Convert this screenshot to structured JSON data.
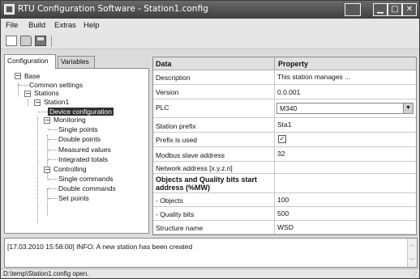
{
  "window": {
    "title": "RTU Configuration Software - Station1.config"
  },
  "menu": {
    "file": "File",
    "build": "Build",
    "extras": "Extras",
    "help": "Help"
  },
  "tabs": {
    "configuration": "Configuration",
    "variables": "Variables"
  },
  "tree": {
    "base": "Base",
    "common_settings": "Common settings",
    "stations": "Stations",
    "station1": "Station1",
    "device_configuration": "Device configuration",
    "monitoring": "Monitoring",
    "single_points": "Single points",
    "double_points": "Double points",
    "measured_values": "Measured values",
    "integrated_totals": "Integrated totals",
    "controlling": "Controlling",
    "single_commands": "Single commands",
    "double_commands": "Double commands",
    "set_points": "Set points"
  },
  "grid": {
    "header_data": "Data",
    "header_property": "Property",
    "rows": [
      {
        "key": "Description",
        "value": "This station manages ..."
      },
      {
        "key": "Version",
        "value": "0.0.001"
      },
      {
        "key": "PLC",
        "value": "M340"
      },
      {
        "key": "Station prefix",
        "value": "Sta1"
      },
      {
        "key": "Prefix is used",
        "value": "checked"
      },
      {
        "key": "Modbus slave address",
        "value": "32"
      },
      {
        "key": "Network address [x.y.z.n]",
        "value": ""
      },
      {
        "key": "Objects and Quality bits start address (%MW)",
        "value": ""
      },
      {
        "key": "- Objects",
        "value": "100"
      },
      {
        "key": "- Quality bits",
        "value": "500"
      },
      {
        "key": "Structure name",
        "value": "WSD"
      }
    ]
  },
  "log": {
    "line1": "[17.03.2010 15:58:00] INFO: A new station has been created"
  },
  "status": {
    "text": "D:\\temp\\Station1.config open."
  },
  "icons": [
    "app-icon",
    "new-file-icon",
    "open-folder-icon",
    "save-icon",
    "minimize-icon",
    "maximize-icon",
    "close-icon",
    "chevron-down-icon",
    "checkmark-icon"
  ]
}
